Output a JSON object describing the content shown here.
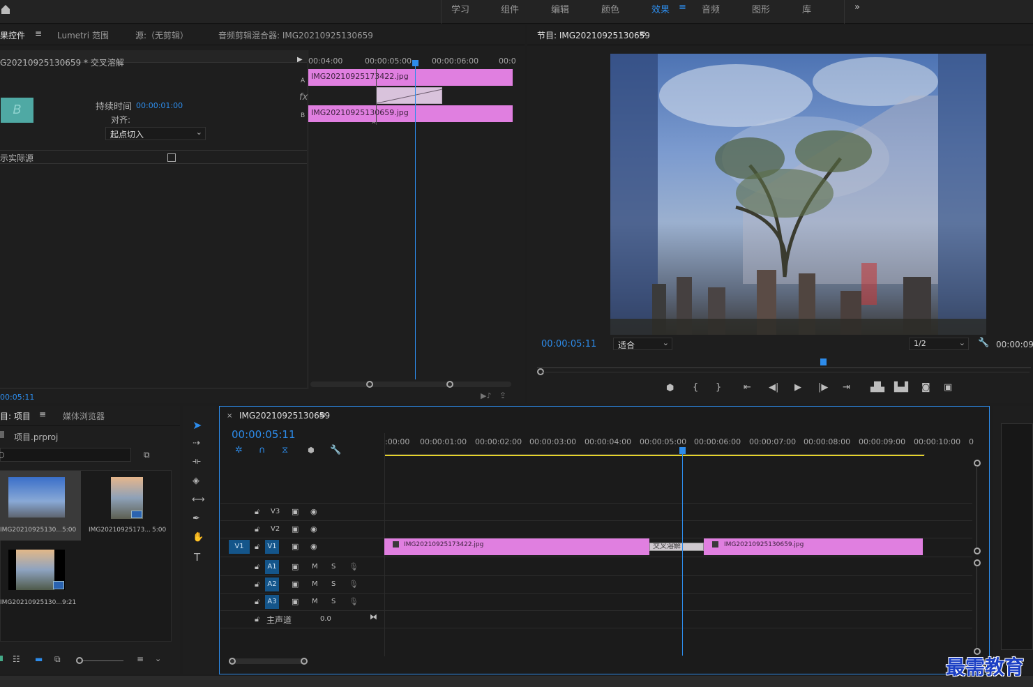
{
  "workspaces": [
    {
      "label": "学习"
    },
    {
      "label": "组件"
    },
    {
      "label": "编辑"
    },
    {
      "label": "颜色"
    },
    {
      "label": "效果",
      "active": true
    },
    {
      "label": "音频"
    },
    {
      "label": "图形"
    },
    {
      "label": "库"
    }
  ],
  "effect_controls": {
    "tabs": [
      "果控件",
      "Lumetri 范围",
      "源:（无剪辑）",
      "音频剪辑混合器: IMG20210925130659"
    ],
    "clip_path": "G20210925130659 * 交叉溶解",
    "duration_label": "持续时间",
    "duration_value": "00:00:01:00",
    "align_label": "对齐:",
    "align_value": "起点切入",
    "show_actual_sources": "示实际源",
    "timecode": "00:05:11",
    "thumb_letter": "B",
    "row_a": "A",
    "row_b": "B",
    "fx": "fx",
    "ruler": [
      "00:04:00",
      "00:00:05:00",
      "00:00:06:00",
      "00:0"
    ],
    "clip_a": "IMG20210925173422.jpg",
    "clip_b": "IMG20210925130659.jpg"
  },
  "program_monitor": {
    "title": "节目: IMG20210925130659",
    "timecode": "00:00:05:11",
    "fit": "适合",
    "resolution": "1/2",
    "duration": "00:00:09"
  },
  "project": {
    "tabs": [
      "目: 项目",
      "媒体浏览器"
    ],
    "project_file": "项目.prproj",
    "items": [
      {
        "name": "IMG20210925130...",
        "duration": "5:00"
      },
      {
        "name": "IMG20210925173...",
        "duration": "5:00"
      },
      {
        "name": "IMG20210925130...",
        "duration": "9:21"
      }
    ]
  },
  "timeline": {
    "sequence": "IMG20210925130659",
    "timecode": "00:00:05:11",
    "ruler": [
      ":00:00",
      "00:00:01:00",
      "00:00:02:00",
      "00:00:03:00",
      "00:00:04:00",
      "00:00:05:00",
      "00:00:06:00",
      "00:00:07:00",
      "00:00:08:00",
      "00:00:09:00",
      "00:00:10:00",
      "0"
    ],
    "video_tracks": [
      "V3",
      "V2",
      "V1"
    ],
    "source_v1": "V1",
    "audio_tracks": [
      "A1",
      "A2",
      "A3"
    ],
    "m": "M",
    "s": "S",
    "master": "主声道",
    "master_value": "0.0",
    "clip1": "IMG20210925173422.jpg",
    "transition": "交叉溶解",
    "clip2": "IMG20210925130659.jpg"
  },
  "watermark": "最需教育",
  "accent": "#2d8ceb",
  "clip_color": "#e07fe0"
}
